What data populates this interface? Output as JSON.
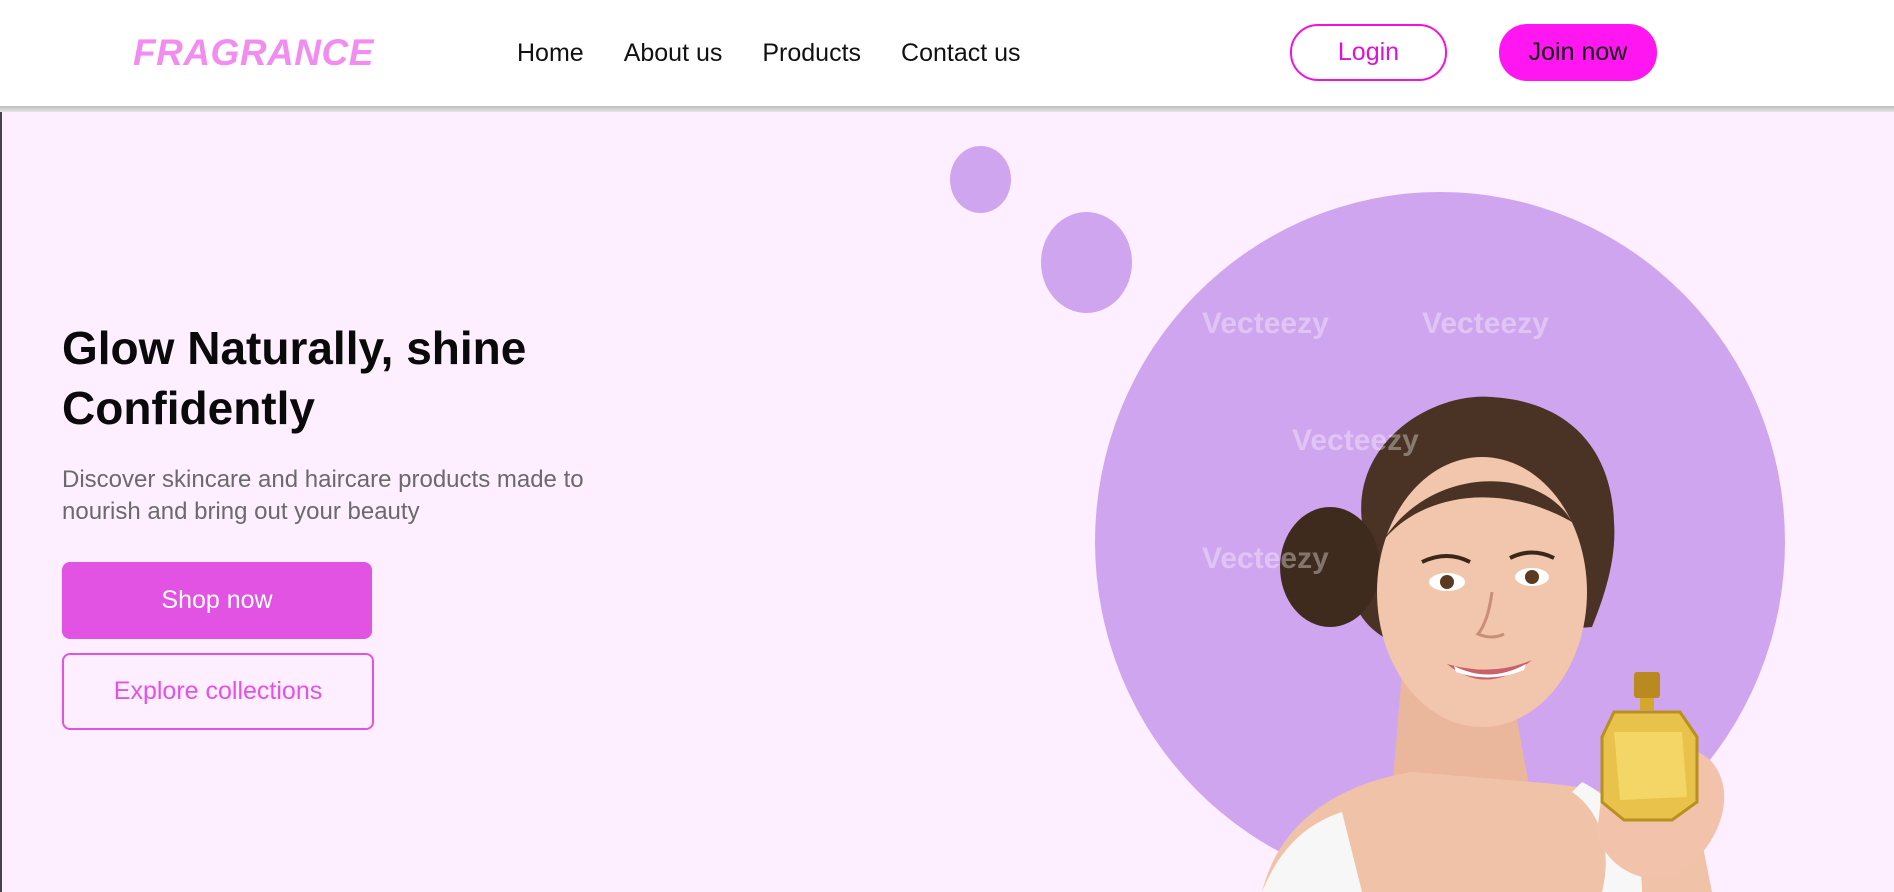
{
  "brand": {
    "logo": "FRAGRANCE"
  },
  "nav": {
    "links": [
      "Home",
      "About us",
      "Products",
      "Contact us"
    ],
    "login": "Login",
    "join": "Join now"
  },
  "hero": {
    "headline": "Glow Naturally, shine Confidently",
    "subtext": "Discover skincare and haircare products made to nourish and bring out your beauty",
    "primary_cta": "Shop now",
    "secondary_cta": "Explore collections",
    "image_watermark": "Vecteezy"
  },
  "colors": {
    "logo": "#f38cf0",
    "accent": "#ff16f0",
    "button": "#e252e3",
    "hero_bg": "#fdefff",
    "bubble": "#cfa5ef"
  }
}
